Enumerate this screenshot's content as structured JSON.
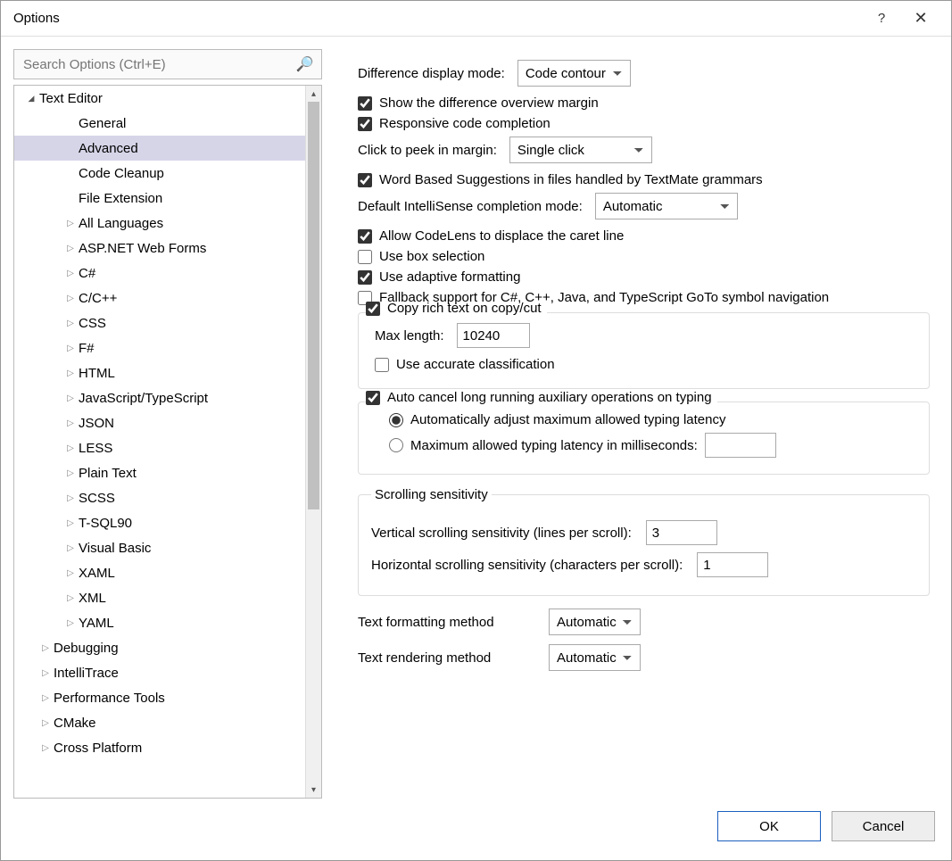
{
  "window": {
    "title": "Options"
  },
  "search": {
    "placeholder": "Search Options (Ctrl+E)"
  },
  "tree": [
    {
      "label": "Text Editor",
      "level": 0,
      "exp": "expanded"
    },
    {
      "label": "General",
      "level": 2,
      "exp": null,
      "nochevron": true
    },
    {
      "label": "Advanced",
      "level": 2,
      "exp": null,
      "selected": true,
      "nochevron": true
    },
    {
      "label": "Code Cleanup",
      "level": 2,
      "exp": null,
      "nochevron": true
    },
    {
      "label": "File Extension",
      "level": 2,
      "exp": null,
      "nochevron": true
    },
    {
      "label": "All Languages",
      "level": 2,
      "exp": "collapsed"
    },
    {
      "label": "ASP.NET Web Forms",
      "level": 2,
      "exp": "collapsed"
    },
    {
      "label": "C#",
      "level": 2,
      "exp": "collapsed"
    },
    {
      "label": "C/C++",
      "level": 2,
      "exp": "collapsed"
    },
    {
      "label": "CSS",
      "level": 2,
      "exp": "collapsed"
    },
    {
      "label": "F#",
      "level": 2,
      "exp": "collapsed"
    },
    {
      "label": "HTML",
      "level": 2,
      "exp": "collapsed"
    },
    {
      "label": "JavaScript/TypeScript",
      "level": 2,
      "exp": "collapsed"
    },
    {
      "label": "JSON",
      "level": 2,
      "exp": "collapsed"
    },
    {
      "label": "LESS",
      "level": 2,
      "exp": "collapsed"
    },
    {
      "label": "Plain Text",
      "level": 2,
      "exp": "collapsed"
    },
    {
      "label": "SCSS",
      "level": 2,
      "exp": "collapsed"
    },
    {
      "label": "T-SQL90",
      "level": 2,
      "exp": "collapsed"
    },
    {
      "label": "Visual Basic",
      "level": 2,
      "exp": "collapsed"
    },
    {
      "label": "XAML",
      "level": 2,
      "exp": "collapsed"
    },
    {
      "label": "XML",
      "level": 2,
      "exp": "collapsed"
    },
    {
      "label": "YAML",
      "level": 2,
      "exp": "collapsed"
    },
    {
      "label": "Debugging",
      "level": 1,
      "exp": "collapsed"
    },
    {
      "label": "IntelliTrace",
      "level": 1,
      "exp": "collapsed"
    },
    {
      "label": "Performance Tools",
      "level": 1,
      "exp": "collapsed"
    },
    {
      "label": "CMake",
      "level": 1,
      "exp": "collapsed"
    },
    {
      "label": "Cross Platform",
      "level": 1,
      "exp": "collapsed"
    }
  ],
  "form": {
    "diff_mode_label": "Difference display mode:",
    "diff_mode_value": "Code contour",
    "show_diff_margin": "Show the difference overview margin",
    "responsive_completion": "Responsive code completion",
    "click_peek_label": "Click to peek in margin:",
    "click_peek_value": "Single click",
    "word_based": "Word Based Suggestions in files handled by TextMate grammars",
    "default_intellisense_label": "Default IntelliSense completion mode:",
    "default_intellisense_value": "Automatic",
    "allow_codelens": "Allow CodeLens to displace the caret line",
    "use_box_selection": "Use box selection",
    "use_adaptive_formatting": "Use adaptive formatting",
    "fallback_goto": "Fallback support for C#, C++, Java, and TypeScript GoTo symbol navigation",
    "copy_rich": "Copy rich text on copy/cut",
    "max_length_label": "Max length:",
    "max_length_value": "10240",
    "use_accurate_classification": "Use accurate classification",
    "auto_cancel": "Auto cancel long running auxiliary operations on typing",
    "radio_auto": "Automatically adjust maximum allowed typing latency",
    "radio_max_ms": "Maximum allowed typing latency in milliseconds:",
    "scroll_legend": "Scrolling sensitivity",
    "vscroll_label": "Vertical scrolling sensitivity (lines per scroll):",
    "vscroll_value": "3",
    "hscroll_label": "Horizontal scrolling sensitivity (characters per scroll):",
    "hscroll_value": "1",
    "text_fmt_label": "Text formatting method",
    "text_fmt_value": "Automatic",
    "text_render_label": "Text rendering method",
    "text_render_value": "Automatic"
  },
  "buttons": {
    "ok": "OK",
    "cancel": "Cancel"
  }
}
